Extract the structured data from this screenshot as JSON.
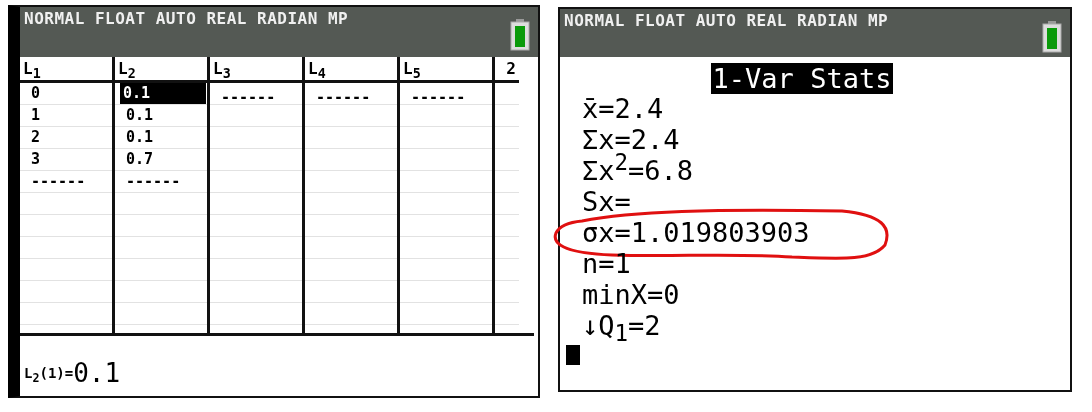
{
  "list_screen": {
    "status_bar": {
      "modes": "NORMAL FLOAT AUTO REAL RADIAN MP"
    },
    "columns": [
      {
        "header": "L$_{1}$",
        "cells": [
          {
            "text": "0",
            "selected": false
          },
          {
            "text": "1",
            "selected": false
          },
          {
            "text": "2",
            "selected": false
          },
          {
            "text": "3",
            "selected": false
          },
          {
            "text": "------",
            "selected": false
          }
        ]
      },
      {
        "header": "L$_{2}$",
        "cells": [
          {
            "text": "0.1",
            "selected": true
          },
          {
            "text": "0.1",
            "selected": false
          },
          {
            "text": "0.1",
            "selected": false
          },
          {
            "text": "0.7",
            "selected": false
          },
          {
            "text": "------",
            "selected": false
          }
        ]
      },
      {
        "header": "L$_{3}$",
        "cells": [
          {
            "text": "------",
            "selected": false
          }
        ]
      },
      {
        "header": "L$_{4}$",
        "cells": [
          {
            "text": "------",
            "selected": false
          }
        ]
      },
      {
        "header": "L$_{5}$",
        "cells": [
          {
            "text": "------",
            "selected": false
          }
        ]
      },
      {
        "header": "2"
      }
    ],
    "entry": {
      "label": "L$_{2}$(1)=",
      "value": "0.1"
    }
  },
  "stats_screen": {
    "status_bar": {
      "modes": "NORMAL FLOAT AUTO REAL RADIAN MP"
    },
    "title": "1-Var Stats",
    "lines": [
      {
        "text": "x̄=2.4",
        "circled": false
      },
      {
        "text": "Σx=2.4",
        "circled": false
      },
      {
        "text": "Σx$^{2}$=6.8",
        "circled": false
      },
      {
        "text": "Sx=",
        "circled": false
      },
      {
        "text": "σx=1.019803903",
        "circled": true
      },
      {
        "text": "n=1",
        "circled": false
      },
      {
        "text": "minX=0",
        "circled": false
      },
      {
        "text": "↓Q$_{1}$=2",
        "circled": false
      }
    ],
    "cursor": true
  }
}
